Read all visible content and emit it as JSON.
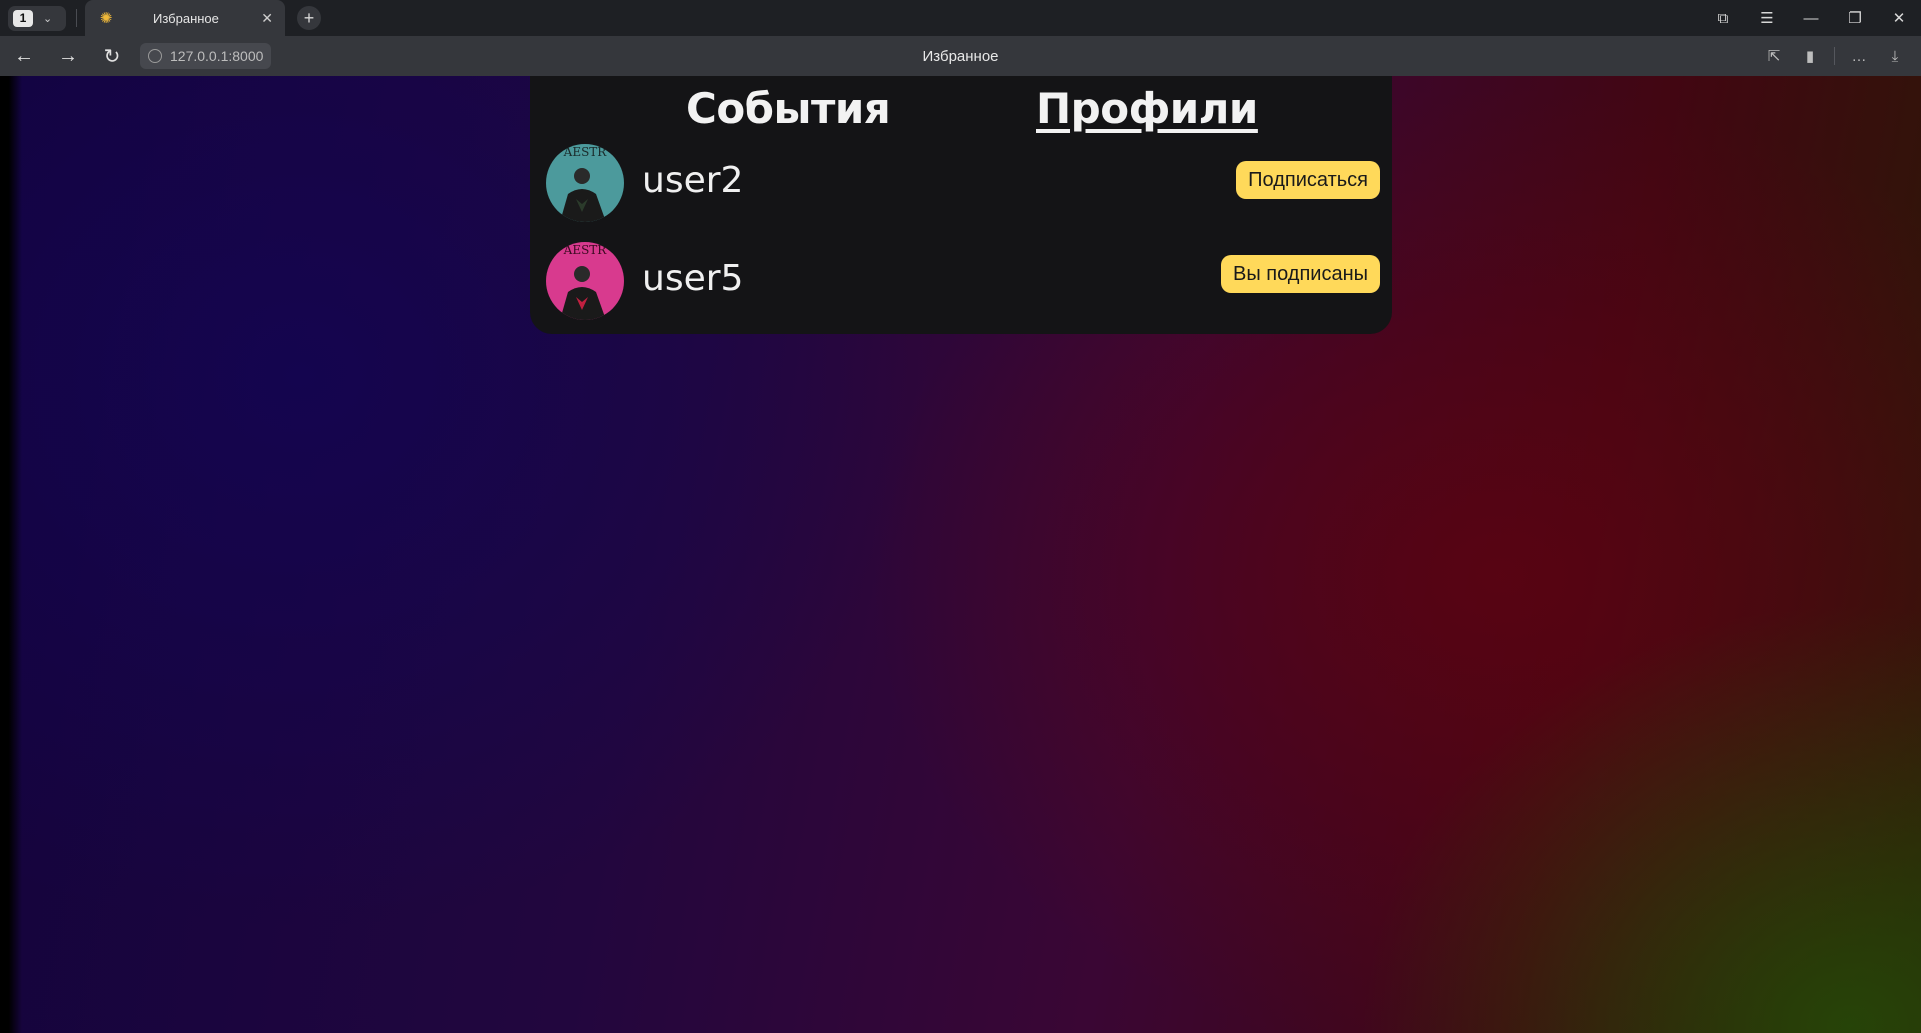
{
  "browser": {
    "tab_count": "1",
    "tab_title": "Избранное",
    "url": "127.0.0.1:8000",
    "page_title": "Избранное"
  },
  "page": {
    "tabs": {
      "events": "События",
      "profiles": "Профили"
    },
    "profiles": [
      {
        "username": "user2",
        "button": "Подписаться",
        "avatar_color": "#4c9a9c"
      },
      {
        "username": "user5",
        "button": "Вы подписаны",
        "avatar_color": "#d83a8e"
      }
    ]
  },
  "colors": {
    "accent_button": "#ffd95a",
    "card_bg": "#141416"
  }
}
